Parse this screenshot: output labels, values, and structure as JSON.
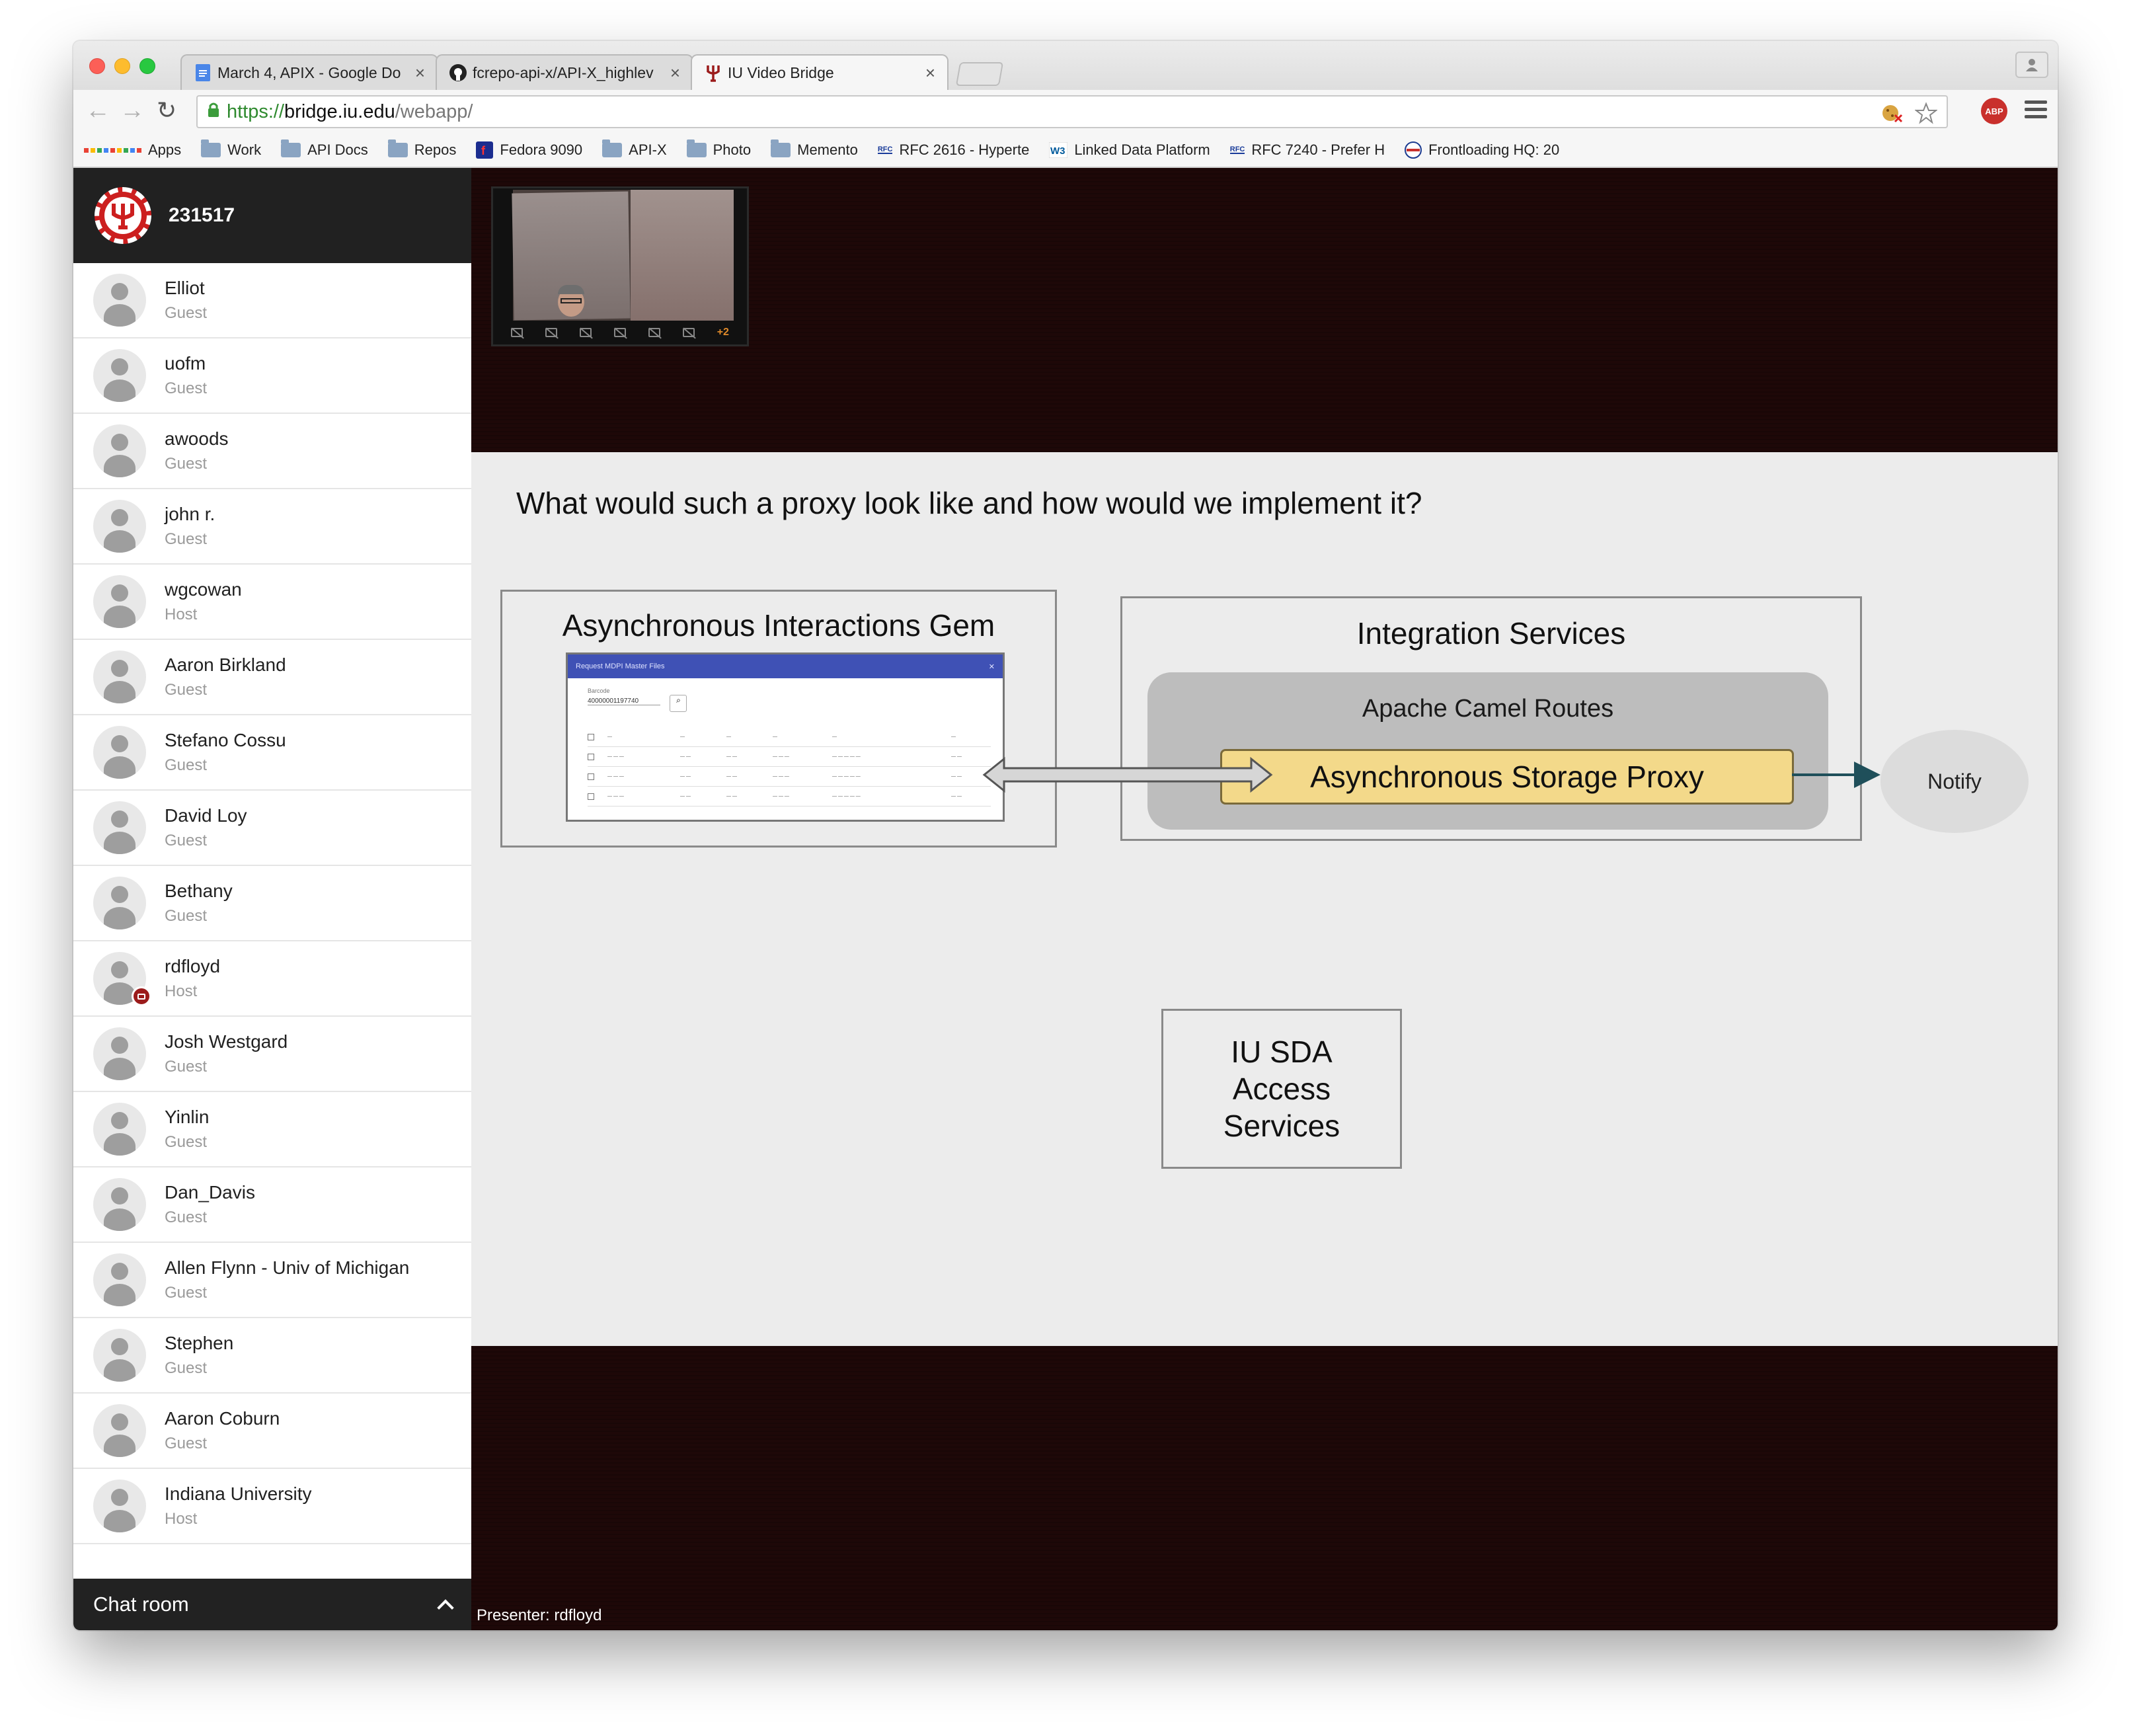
{
  "browser": {
    "tabs": [
      {
        "title": "March 4, APIX - Google Do",
        "icon": "google-docs-icon",
        "active": false
      },
      {
        "title": "fcrepo-api-x/API-X_highlev",
        "icon": "github-icon",
        "active": false
      },
      {
        "title": "IU Video Bridge",
        "icon": "iu-trident-icon",
        "active": true
      }
    ],
    "url": {
      "scheme": "https://",
      "host": "bridge.iu.edu",
      "path": "/webapp/"
    },
    "extension_abp": "ABP",
    "bookmarks": [
      {
        "label": "Apps",
        "icon": "apps-grid-icon"
      },
      {
        "label": "Work",
        "icon": "folder-icon"
      },
      {
        "label": "API Docs",
        "icon": "folder-icon"
      },
      {
        "label": "Repos",
        "icon": "folder-icon"
      },
      {
        "label": "Fedora 9090",
        "icon": "fedora-icon"
      },
      {
        "label": "API-X",
        "icon": "folder-icon"
      },
      {
        "label": "Photo",
        "icon": "folder-icon"
      },
      {
        "label": "Memento",
        "icon": "folder-icon"
      },
      {
        "label": "RFC 2616 - Hyperte",
        "icon": "rfc-icon"
      },
      {
        "label": "Linked Data Platform",
        "icon": "w3c-icon"
      },
      {
        "label": "RFC 7240 - Prefer H",
        "icon": "rfc-icon"
      },
      {
        "label": "Frontloading HQ: 20",
        "icon": "frontloading-icon"
      }
    ]
  },
  "sidebar": {
    "room_id": "231517",
    "participants": [
      {
        "name": "Elliot",
        "role": "Guest"
      },
      {
        "name": "uofm",
        "role": "Guest"
      },
      {
        "name": "awoods",
        "role": "Guest"
      },
      {
        "name": "john r.",
        "role": "Guest"
      },
      {
        "name": "wgcowan",
        "role": "Host"
      },
      {
        "name": "Aaron Birkland",
        "role": "Guest"
      },
      {
        "name": "Stefano Cossu",
        "role": "Guest"
      },
      {
        "name": "David Loy",
        "role": "Guest"
      },
      {
        "name": "Bethany",
        "role": "Guest"
      },
      {
        "name": "rdfloyd",
        "role": "Host",
        "presenting": true
      },
      {
        "name": "Josh Westgard",
        "role": "Guest"
      },
      {
        "name": "Yinlin",
        "role": "Guest"
      },
      {
        "name": "Dan_Davis",
        "role": "Guest"
      },
      {
        "name": "Allen Flynn - Univ of Michigan",
        "role": "Guest"
      },
      {
        "name": "Stephen",
        "role": "Guest"
      },
      {
        "name": "Aaron Coburn",
        "role": "Guest"
      },
      {
        "name": "Indiana University",
        "role": "Host"
      }
    ],
    "chat_label": "Chat room"
  },
  "video": {
    "more_count": "+2"
  },
  "slide": {
    "question": "What would such a proxy look like and how would we implement it?",
    "gem_title": "Asynchronous Interactions Gem",
    "dialog_title": "Request MDPI Master Files",
    "dialog_field_label": "Barcode",
    "dialog_field_value": "40000001197740",
    "integration_title": "Integration Services",
    "camel_title": "Apache Camel Routes",
    "proxy_label": "Asynchronous Storage Proxy",
    "notify_label": "Notify",
    "sda_line1": "IU SDA",
    "sda_line2": "Access",
    "sda_line3": "Services"
  },
  "presenter_label": "Presenter: rdfloyd",
  "colors": {
    "iu_red": "#cc1f1f",
    "proxy_fill": "#f3d98a",
    "dialog_bar": "#3f51b5",
    "main_bg": "#1e0808"
  }
}
